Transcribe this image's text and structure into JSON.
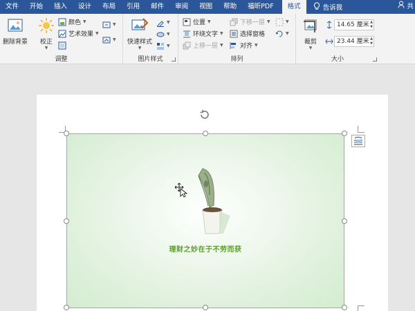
{
  "tabs": [
    "文件",
    "开始",
    "插入",
    "设计",
    "布局",
    "引用",
    "邮件",
    "审阅",
    "视图",
    "帮助",
    "福昕PDF"
  ],
  "active_tab": "格式",
  "tell_me": "告诉我",
  "share": "共",
  "groups": {
    "adjust": {
      "label": "调整",
      "remove_bg": "删除背景",
      "correct": "校正",
      "color": "颜色",
      "art_effect": "艺术效果"
    },
    "style": {
      "label": "图片样式",
      "quick_styles": "快速样式"
    },
    "arrange": {
      "label": "排列",
      "position": "位置",
      "wrap_text": "环绕文字",
      "bring_forward": "上移一层",
      "send_backward": "下移一层",
      "selection_pane": "选择窗格",
      "align": "对齐"
    },
    "size": {
      "label": "大小",
      "crop": "裁剪",
      "height": "14.65 厘米",
      "width": "23.44 厘米"
    }
  },
  "picture": {
    "slogan": "理财之妙在于不劳而获"
  },
  "colors": {
    "brand": "#2b579a",
    "slogan": "#5c9c2e"
  }
}
